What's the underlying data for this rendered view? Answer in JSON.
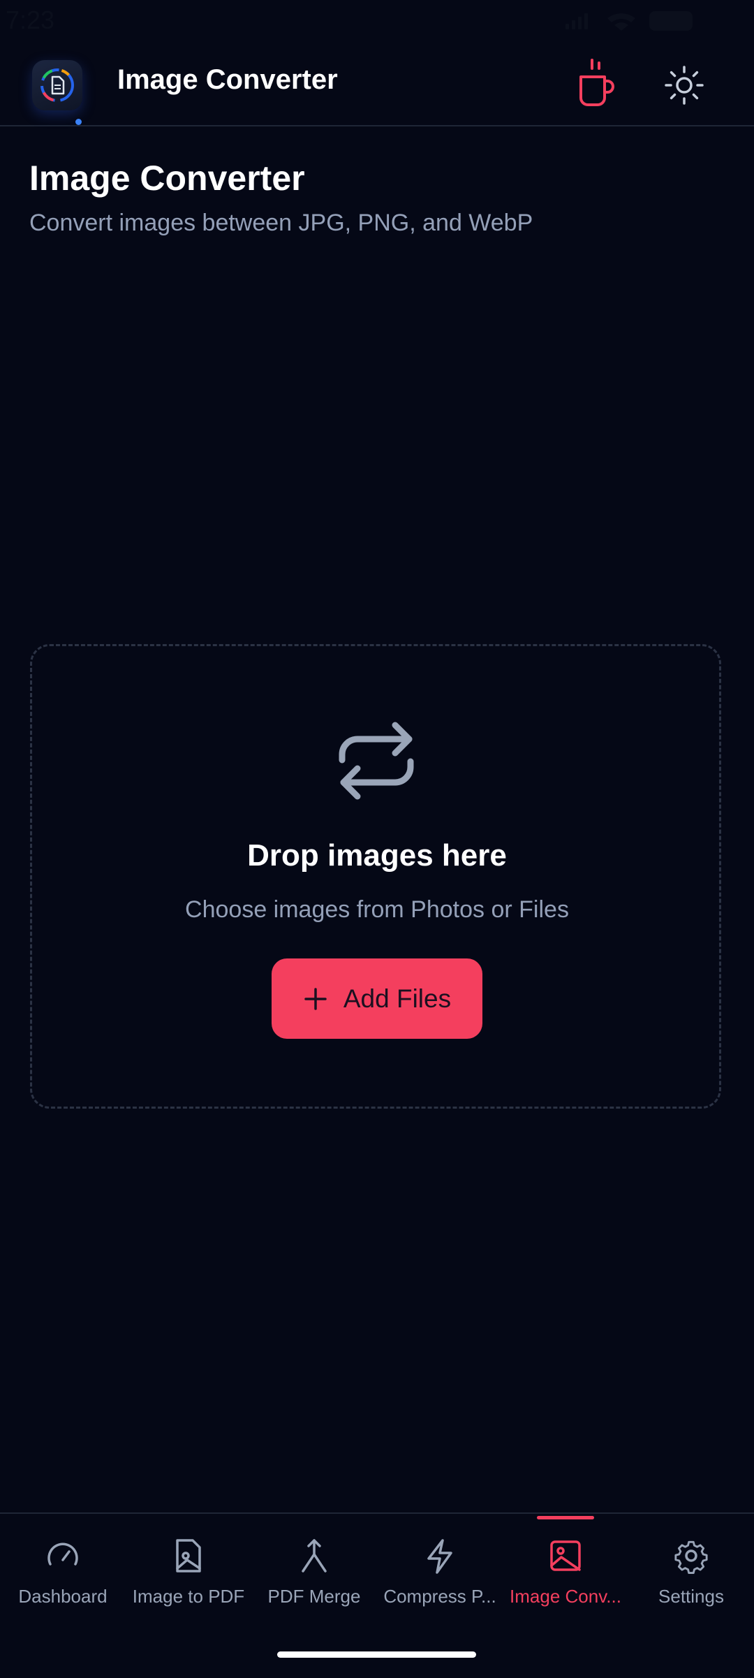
{
  "status_bar": {
    "time": "7:23"
  },
  "header": {
    "app_title": "Image Converter"
  },
  "page": {
    "title": "Image Converter",
    "subtitle": "Convert images between JPG, PNG, and WebP"
  },
  "drop_zone": {
    "title": "Drop images here",
    "subtitle": "Choose images from Photos or Files",
    "add_button_label": "Add Files"
  },
  "nav": {
    "active": "Image Conv...",
    "items": [
      {
        "label": "Dashboard",
        "icon": "gauge-icon"
      },
      {
        "label": "Image to PDF",
        "icon": "image-file-icon"
      },
      {
        "label": "PDF Merge",
        "icon": "merge-icon"
      },
      {
        "label": "Compress P...",
        "icon": "lightning-icon"
      },
      {
        "label": "Image Conv...",
        "icon": "image-icon"
      },
      {
        "label": "Settings",
        "icon": "gear-icon"
      }
    ]
  },
  "colors": {
    "background": "#050816",
    "accent": "#f43f5e",
    "muted_text": "#94a0b8",
    "icon_gray": "#9aa5b8"
  }
}
